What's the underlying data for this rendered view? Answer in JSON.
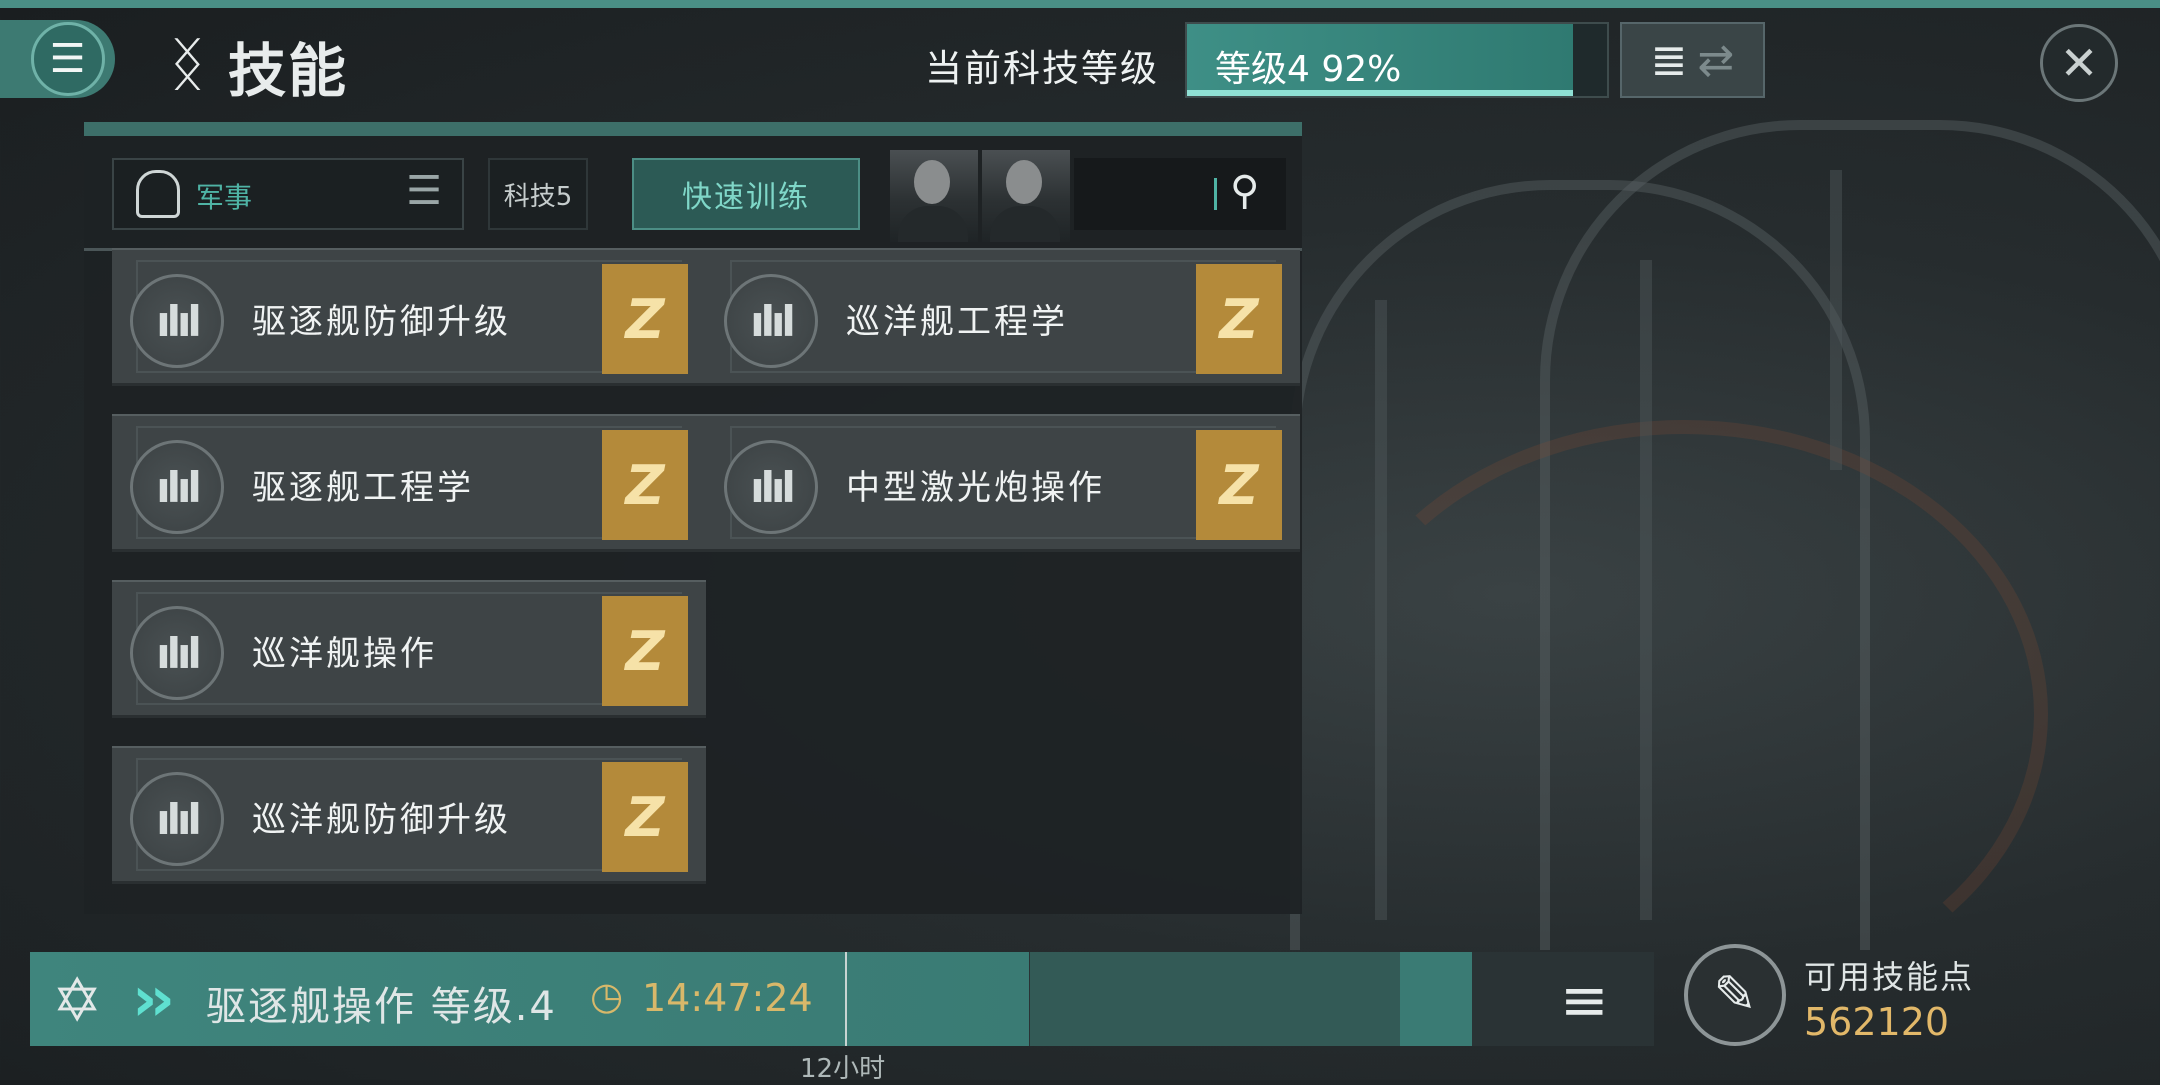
{
  "header": {
    "title": "技能",
    "title_icon": "dna-icon",
    "tech_level_label": "当前科技等级",
    "level_text": "等级4  92%",
    "level_progress": 0.92
  },
  "filter": {
    "category": "军事",
    "tech_chip": "科技5",
    "quick_train": "快速训练"
  },
  "skills": [
    {
      "name": "驱逐舰防御升级",
      "badge": "Z"
    },
    {
      "name": "巡洋舰工程学",
      "badge": "Z"
    },
    {
      "name": "驱逐舰工程学",
      "badge": "Z"
    },
    {
      "name": "中型激光炮操作",
      "badge": "Z"
    },
    {
      "name": "巡洋舰操作",
      "badge": "Z"
    },
    {
      "name": "巡洋舰防御升级",
      "badge": "Z"
    }
  ],
  "queue": {
    "current": "驱逐舰操作 等级.4",
    "time": "14:47:24",
    "marker_label": "12小时"
  },
  "skill_points": {
    "label": "可用技能点",
    "value": "562120"
  },
  "colors": {
    "accent": "#3e8f86",
    "badge": "#b48a3a",
    "gold_text": "#e2b869",
    "teal_text": "#4fb3a5"
  }
}
